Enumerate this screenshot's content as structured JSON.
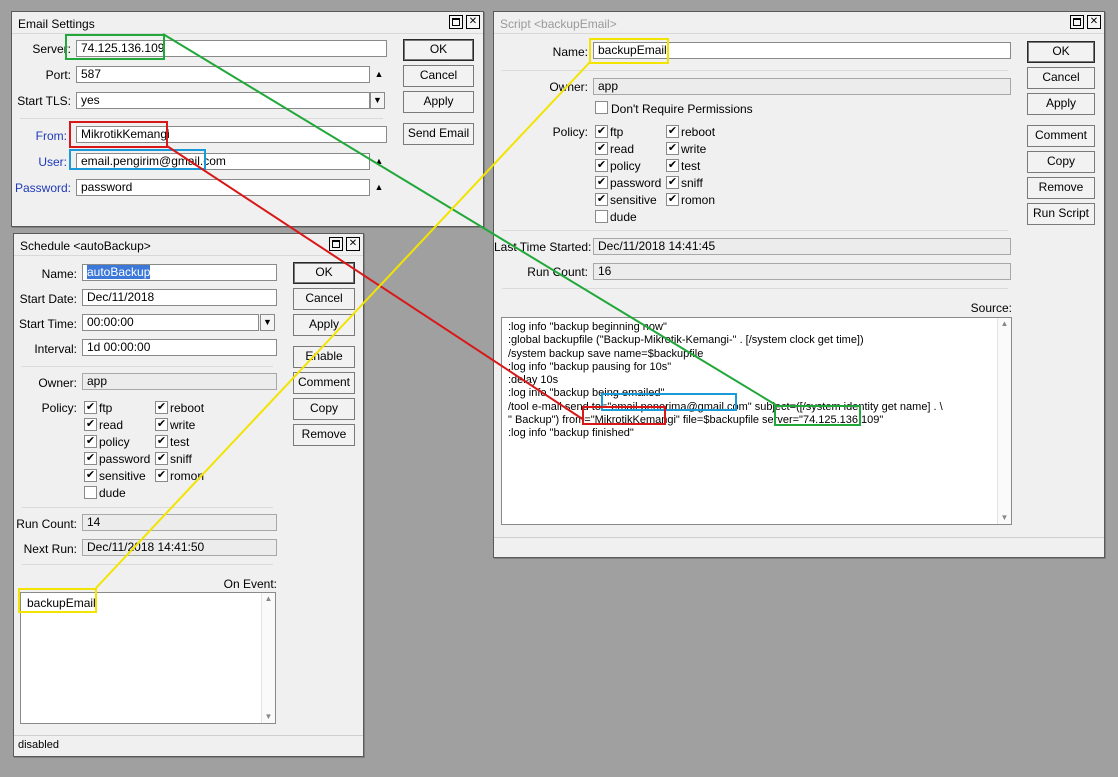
{
  "colors": {
    "desktop": "#a0a0a0",
    "highlight_green": "#22a83a",
    "highlight_red": "#d81818",
    "highlight_blue": "#1a9ad8",
    "highlight_yellow": "#f2e400"
  },
  "email": {
    "title": "Email Settings",
    "server_label": "Server:",
    "server": "74.125.136.109",
    "port_label": "Port:",
    "port": "587",
    "tls_label": "Start TLS:",
    "tls": "yes",
    "from_label": "From:",
    "from": "MikrotikKemangi",
    "user_label": "User:",
    "user": "email.pengirim@gmail.com",
    "password_label": "Password:",
    "password": "password",
    "buttons": {
      "ok": "OK",
      "cancel": "Cancel",
      "apply": "Apply",
      "send": "Send Email"
    }
  },
  "script": {
    "title": "Script <backupEmail>",
    "name_label": "Name:",
    "name": "backupEmail",
    "owner_label": "Owner:",
    "owner": "app",
    "dont_require_label": "Don't Require Permissions",
    "policy_label": "Policy:",
    "policies_left": [
      "ftp",
      "read",
      "policy",
      "password",
      "sensitive",
      "dude"
    ],
    "policies_right": [
      "reboot",
      "write",
      "test",
      "sniff",
      "romon"
    ],
    "last_started_label": "Last Time Started:",
    "last_started": "Dec/11/2018 14:41:45",
    "run_count_label": "Run Count:",
    "run_count": "16",
    "source_label": "Source:",
    "source_lines": [
      ":log info \"backup beginning now\"",
      ":global backupfile (\"Backup-Mikrotik-Kemangi-\" . [/system clock get time])",
      "/system backup save name=$backupfile",
      ":log info \"backup pausing for 10s\"",
      ":delay 10s",
      ":log info \"backup being emailed\"",
      "/tool e-mail send to=\"email.penerima@gmail.com\" subject=([/system identity get name] . \\",
      "\" Backup\") from=\"MikrotikKemangi\" file=$backupfile server=\"74.125.136.109\"",
      ":log info \"backup finished\""
    ],
    "buttons": {
      "ok": "OK",
      "cancel": "Cancel",
      "apply": "Apply",
      "comment": "Comment",
      "copy": "Copy",
      "remove": "Remove",
      "run": "Run Script"
    }
  },
  "schedule": {
    "title": "Schedule <autoBackup>",
    "name_label": "Name:",
    "name": "autoBackup",
    "start_date_label": "Start Date:",
    "start_date": "Dec/11/2018",
    "start_time_label": "Start Time:",
    "start_time": "00:00:00",
    "interval_label": "Interval:",
    "interval": "1d 00:00:00",
    "owner_label": "Owner:",
    "owner": "app",
    "policy_label": "Policy:",
    "policies_left": [
      "ftp",
      "read",
      "policy",
      "password",
      "sensitive",
      "dude"
    ],
    "policies_right": [
      "reboot",
      "write",
      "test",
      "sniff",
      "romon"
    ],
    "run_count_label": "Run Count:",
    "run_count": "14",
    "next_run_label": "Next Run:",
    "next_run": "Dec/11/2018 14:41:50",
    "on_event_label": "On Event:",
    "on_event": "backupEmail",
    "status": "disabled",
    "buttons": {
      "ok": "OK",
      "cancel": "Cancel",
      "apply": "Apply",
      "enable": "Enable",
      "comment": "Comment",
      "copy": "Copy",
      "remove": "Remove"
    }
  },
  "icons": {
    "restore": "restore-icon",
    "close": "close-icon",
    "check": "✔",
    "close_glyph": "✕"
  }
}
